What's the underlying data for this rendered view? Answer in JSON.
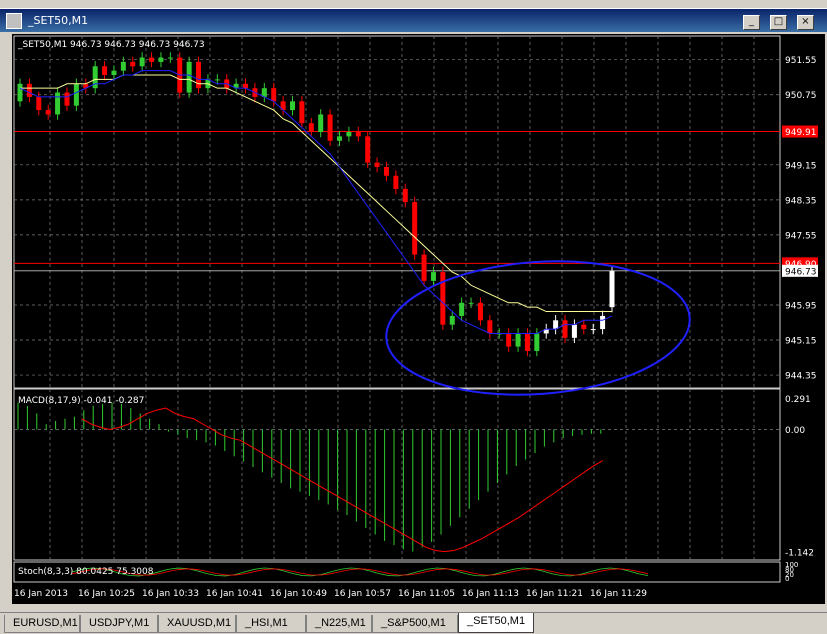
{
  "window": {
    "title": "_SET50,M1"
  },
  "chart_header": "_SET50,M1  946.73 946.73 946.73 946.73",
  "price_axis": {
    "ticks": [
      "951.55",
      "950.75",
      "949.91",
      "949.15",
      "948.35",
      "947.55",
      "946.90",
      "946.73",
      "945.95",
      "945.15",
      "944.35"
    ],
    "tick_values": [
      951.55,
      950.75,
      949.91,
      949.15,
      948.35,
      947.55,
      946.9,
      946.73,
      945.95,
      945.15,
      944.35
    ],
    "red_levels": [
      949.91,
      946.9
    ],
    "current_price": 946.73
  },
  "macd": {
    "label": "MACD(8,17,9) -0.041 -0.287",
    "ticks": [
      "0.291",
      "0.00",
      "-1.142"
    ],
    "tick_values": [
      0.291,
      0.0,
      -1.142
    ]
  },
  "stoch": {
    "label": "Stoch(8,3,3) 80.0425 75.3008",
    "ticks": [
      "100",
      "80",
      "20",
      "0"
    ]
  },
  "time_axis": [
    "16 Jan 2013",
    "16 Jan 10:25",
    "16 Jan 10:33",
    "16 Jan 10:41",
    "16 Jan 10:49",
    "16 Jan 10:57",
    "16 Jan 11:05",
    "16 Jan 11:13",
    "16 Jan 11:21",
    "16 Jan 11:29"
  ],
  "tabs": [
    "EURUSD,M1",
    "USDJPY,M1",
    "XAUUSD,M1",
    "_HSI,M1",
    "_N225,M1",
    "_S&P500,M1",
    "_SET50,M1"
  ],
  "active_tab": "_SET50,M1",
  "colors": {
    "bull": "#32cd32",
    "bear": "#ff0000",
    "grid": "#808080",
    "ma_slow": "#ffff99",
    "ma_fast": "#2020ff",
    "macd_signal": "#ff0000",
    "macd_hist": "#32cd32",
    "annotation": "#2020ff"
  },
  "chart_data": {
    "type": "candlestick",
    "closes": [
      951.0,
      950.7,
      950.4,
      950.3,
      950.8,
      950.5,
      951.0,
      950.9,
      951.4,
      951.2,
      951.3,
      951.5,
      951.4,
      951.6,
      951.5,
      951.6,
      951.6,
      950.8,
      951.5,
      950.9,
      951.1,
      951.1,
      950.9,
      951.0,
      950.9,
      950.7,
      950.9,
      950.6,
      950.4,
      950.6,
      950.1,
      949.9,
      950.3,
      949.7,
      949.8,
      949.9,
      949.8,
      949.2,
      949.1,
      948.9,
      948.6,
      948.3,
      947.1,
      946.5,
      946.7,
      945.5,
      945.7,
      946.0,
      946.0,
      945.6,
      945.3,
      945.3,
      945.0,
      945.3,
      944.9,
      945.3,
      945.4,
      945.6,
      945.2,
      945.5,
      945.4,
      945.4,
      945.7,
      946.73
    ],
    "opens": [
      950.6,
      951.0,
      950.7,
      950.4,
      950.3,
      950.8,
      950.5,
      951.0,
      950.9,
      951.4,
      951.2,
      951.3,
      951.5,
      951.4,
      951.6,
      951.5,
      951.6,
      951.6,
      950.8,
      951.5,
      950.9,
      951.1,
      951.1,
      950.9,
      951.0,
      950.9,
      950.7,
      950.9,
      950.6,
      950.4,
      950.6,
      950.1,
      949.9,
      950.3,
      949.7,
      949.8,
      949.9,
      949.8,
      949.2,
      949.1,
      948.9,
      948.6,
      948.3,
      947.1,
      946.5,
      946.7,
      945.5,
      945.7,
      946.0,
      946.0,
      945.6,
      945.3,
      945.3,
      945.0,
      945.3,
      944.9,
      945.3,
      945.4,
      945.6,
      945.2,
      945.5,
      945.4,
      945.4,
      945.9
    ],
    "ma_slow": [
      950.9,
      950.9,
      950.9,
      950.9,
      950.9,
      951.0,
      951.0,
      951.0,
      951.1,
      951.1,
      951.1,
      951.2,
      951.2,
      951.2,
      951.2,
      951.2,
      951.2,
      951.1,
      951.1,
      951.0,
      951.0,
      950.9,
      950.9,
      950.8,
      950.7,
      950.6,
      950.5,
      950.4,
      950.2,
      950.1,
      949.9,
      949.7,
      949.5,
      949.3,
      949.1,
      948.9,
      948.7,
      948.5,
      948.3,
      948.1,
      947.9,
      947.7,
      947.5,
      947.3,
      947.1,
      946.9,
      946.7,
      946.6,
      946.4,
      946.3,
      946.2,
      946.1,
      946.0,
      946.0,
      945.9,
      945.9,
      945.8,
      945.8,
      945.8,
      945.8,
      945.8,
      945.8,
      945.8,
      945.8
    ],
    "ma_fast": [
      950.9,
      950.8,
      950.7,
      950.7,
      950.7,
      950.7,
      950.8,
      950.9,
      951.0,
      951.0,
      951.1,
      951.2,
      951.2,
      951.3,
      951.3,
      951.3,
      951.3,
      951.2,
      951.2,
      951.1,
      951.1,
      951.0,
      951.0,
      950.9,
      950.9,
      950.8,
      950.7,
      950.6,
      950.4,
      950.2,
      950.0,
      949.8,
      949.6,
      949.4,
      949.1,
      948.8,
      948.5,
      948.2,
      947.9,
      947.6,
      947.3,
      947.0,
      946.7,
      946.4,
      946.2,
      946.0,
      945.8,
      945.6,
      945.5,
      945.4,
      945.3,
      945.3,
      945.3,
      945.3,
      945.3,
      945.3,
      945.4,
      945.4,
      945.5,
      945.5,
      945.6,
      945.6,
      945.6,
      945.7
    ],
    "macd_hist": [
      0.25,
      0.22,
      0.15,
      0.05,
      0.08,
      0.1,
      0.12,
      0.18,
      0.22,
      0.24,
      0.25,
      0.24,
      0.2,
      0.15,
      0.1,
      0.05,
      -0.02,
      -0.05,
      -0.08,
      -0.1,
      -0.12,
      -0.15,
      -0.2,
      -0.25,
      -0.3,
      -0.35,
      -0.4,
      -0.45,
      -0.5,
      -0.55,
      -0.58,
      -0.62,
      -0.66,
      -0.7,
      -0.75,
      -0.8,
      -0.86,
      -0.92,
      -0.98,
      -1.04,
      -1.08,
      -1.12,
      -1.14,
      -1.1,
      -1.05,
      -0.98,
      -0.9,
      -0.82,
      -0.74,
      -0.66,
      -0.58,
      -0.5,
      -0.42,
      -0.34,
      -0.28,
      -0.22,
      -0.16,
      -0.12,
      -0.08,
      -0.06,
      -0.05,
      -0.04,
      -0.04
    ],
    "macd_signal": [
      0.1,
      0.05,
      0.02,
      0.0,
      0.02,
      0.05,
      0.1,
      0.15,
      0.18,
      0.2,
      0.15,
      0.12,
      0.1,
      0.05,
      0.0,
      -0.05,
      -0.08,
      -0.1,
      -0.15,
      -0.2,
      -0.25,
      -0.3,
      -0.35,
      -0.4,
      -0.45,
      -0.5,
      -0.55,
      -0.6,
      -0.65,
      -0.7,
      -0.75,
      -0.8,
      -0.85,
      -0.9,
      -0.95,
      -1.0,
      -1.05,
      -1.1,
      -1.13,
      -1.14,
      -1.13,
      -1.1,
      -1.06,
      -1.02,
      -0.97,
      -0.92,
      -0.87,
      -0.82,
      -0.76,
      -0.7,
      -0.64,
      -0.58,
      -0.52,
      -0.46,
      -0.4,
      -0.34,
      -0.29
    ]
  }
}
